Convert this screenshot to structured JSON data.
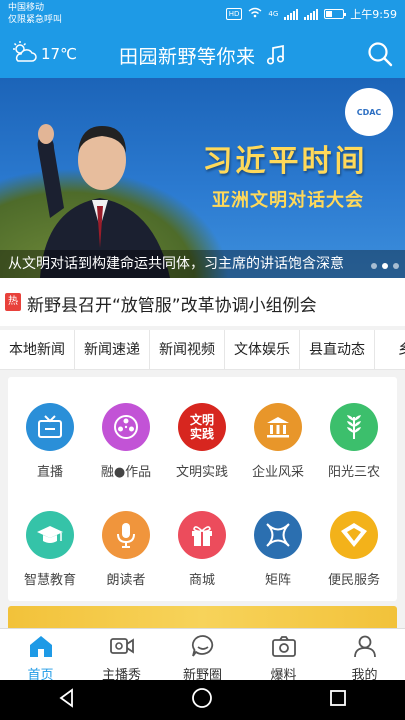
{
  "status": {
    "carrier": "中国移动",
    "emergency": "仅限紧急呼叫",
    "hd": "HD",
    "network": "4G",
    "time": "上午9:59"
  },
  "header": {
    "temperature": "17℃",
    "title": "田园新野等你来"
  },
  "banner": {
    "heading": "习近平时间",
    "subheading": "亚洲文明对话大会",
    "logo": "CDAC",
    "caption": "从文明对话到构建命运共同体，习主席的讲话饱含深意"
  },
  "headline": {
    "badge": "热",
    "text": "新野县召开“放管服”改革协调小组例会"
  },
  "tabs": [
    "本地新闻",
    "新闻速递",
    "新闻视频",
    "文体娱乐",
    "县直动态",
    "乡镇"
  ],
  "grid": [
    {
      "label": "直播",
      "icon": "tv-icon",
      "color": "#2a8fd8"
    },
    {
      "label": "融●作品",
      "icon": "film-reel-icon",
      "color": "#c253d6"
    },
    {
      "label": "文明实践",
      "icon": "wenming-shijian-icon",
      "color": "#d7261f",
      "icon_text": "文明\n实践"
    },
    {
      "label": "企业风采",
      "icon": "building-icon",
      "color": "#e8962a"
    },
    {
      "label": "阳光三农",
      "icon": "wheat-icon",
      "color": "#3cbf6c"
    },
    {
      "label": "智慧教育",
      "icon": "graduation-cap-icon",
      "color": "#35c3a8"
    },
    {
      "label": "朗读者",
      "icon": "microphone-icon",
      "color": "#f0953c"
    },
    {
      "label": "商城",
      "icon": "gift-icon",
      "color": "#ec4c5c"
    },
    {
      "label": "矩阵",
      "icon": "matrix-icon",
      "color": "#2b6fb0"
    },
    {
      "label": "便民服务",
      "icon": "service-icon",
      "color": "#f3b21a"
    }
  ],
  "bottom_nav": [
    {
      "label": "首页",
      "icon": "home-icon",
      "active": true
    },
    {
      "label": "主播秀",
      "icon": "video-camera-icon",
      "active": false
    },
    {
      "label": "新野圈",
      "icon": "chat-bubble-icon",
      "active": false
    },
    {
      "label": "爆料",
      "icon": "camera-icon",
      "active": false
    },
    {
      "label": "我的",
      "icon": "user-icon",
      "active": false
    }
  ],
  "colors": {
    "brand": "#1e9ae6",
    "hot_badge": "#e8413b",
    "banner_text": "#ffd95a"
  }
}
